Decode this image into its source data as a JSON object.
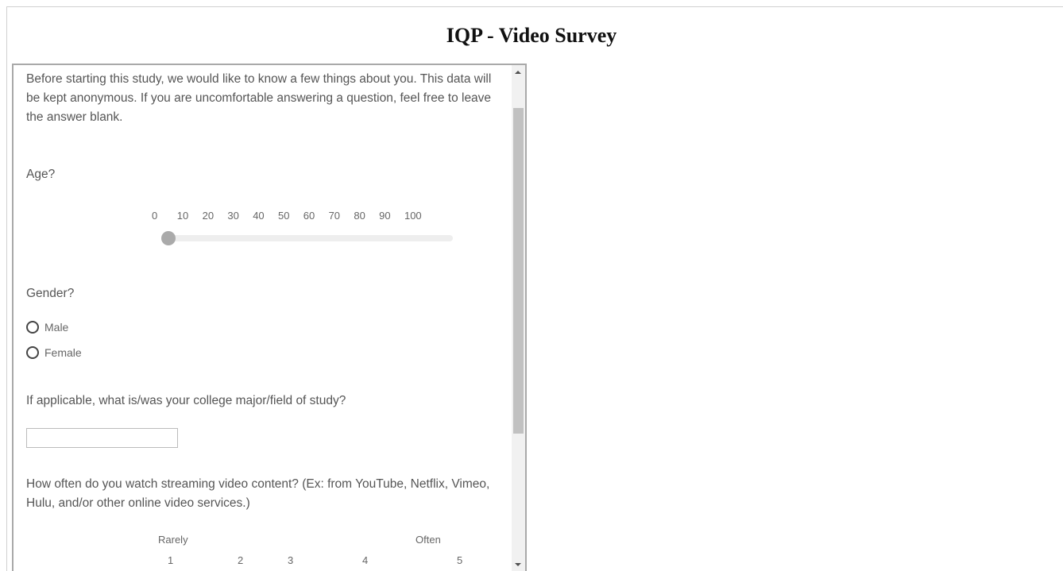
{
  "page": {
    "title": "IQP - Video Survey"
  },
  "survey": {
    "intro": "Before starting this study, we would like to know a few things about you. This data will be kept anonymous. If you are uncomfortable answering a question, feel free to leave the answer blank.",
    "age": {
      "question": "Age?",
      "ticks": [
        "0",
        "10",
        "20",
        "30",
        "40",
        "50",
        "60",
        "70",
        "80",
        "90",
        "100"
      ],
      "value": 0
    },
    "gender": {
      "question": "Gender?",
      "options": [
        "Male",
        "Female"
      ],
      "selected": null
    },
    "major": {
      "question": "If applicable, what is/was your college major/field of study?",
      "value": ""
    },
    "streaming": {
      "question": "How often do you watch streaming video content? (Ex: from YouTube, Netflix, Vimeo, Hulu,  and/or other online video services.)",
      "low_label": "Rarely",
      "high_label": "Often",
      "scale": [
        "1",
        "2",
        "3",
        "4",
        "5"
      ]
    }
  },
  "colors": {
    "text": "#555555",
    "slider_thumb": "#aaaaaa",
    "scroll_thumb": "#c1c1c1"
  }
}
